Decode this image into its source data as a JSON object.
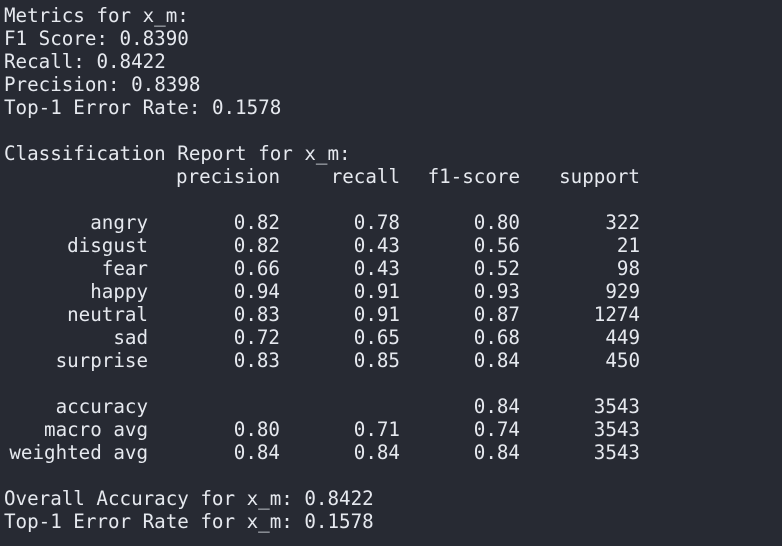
{
  "metrics": {
    "heading": "Metrics for x_m:",
    "rows": [
      {
        "label": "F1 Score:",
        "value": "0.8390"
      },
      {
        "label": "Recall:",
        "value": "0.8422"
      },
      {
        "label": "Precision:",
        "value": "0.8398"
      },
      {
        "label": "Top-1 Error Rate:",
        "value": "0.1578"
      }
    ]
  },
  "report": {
    "heading": "Classification Report for x_m:",
    "columns": [
      "precision",
      "recall",
      "f1-score",
      "support"
    ],
    "classes": [
      {
        "label": "angry",
        "precision": "0.82",
        "recall": "0.78",
        "f1": "0.80",
        "support": "322"
      },
      {
        "label": "disgust",
        "precision": "0.82",
        "recall": "0.43",
        "f1": "0.56",
        "support": "21"
      },
      {
        "label": "fear",
        "precision": "0.66",
        "recall": "0.43",
        "f1": "0.52",
        "support": "98"
      },
      {
        "label": "happy",
        "precision": "0.94",
        "recall": "0.91",
        "f1": "0.93",
        "support": "929"
      },
      {
        "label": "neutral",
        "precision": "0.83",
        "recall": "0.91",
        "f1": "0.87",
        "support": "1274"
      },
      {
        "label": "sad",
        "precision": "0.72",
        "recall": "0.65",
        "f1": "0.68",
        "support": "449"
      },
      {
        "label": "surprise",
        "precision": "0.83",
        "recall": "0.85",
        "f1": "0.84",
        "support": "450"
      }
    ],
    "summary": [
      {
        "label": "accuracy",
        "precision": "",
        "recall": "",
        "f1": "0.84",
        "support": "3543"
      },
      {
        "label": "macro avg",
        "precision": "0.80",
        "recall": "0.71",
        "f1": "0.74",
        "support": "3543"
      },
      {
        "label": "weighted avg",
        "precision": "0.84",
        "recall": "0.84",
        "f1": "0.84",
        "support": "3543"
      }
    ]
  },
  "overall": {
    "accuracy_label": "Overall Accuracy for x_m:",
    "accuracy_value": "0.8422",
    "error_label": "Top-1 Error Rate for x_m:",
    "error_value": "0.1578"
  }
}
